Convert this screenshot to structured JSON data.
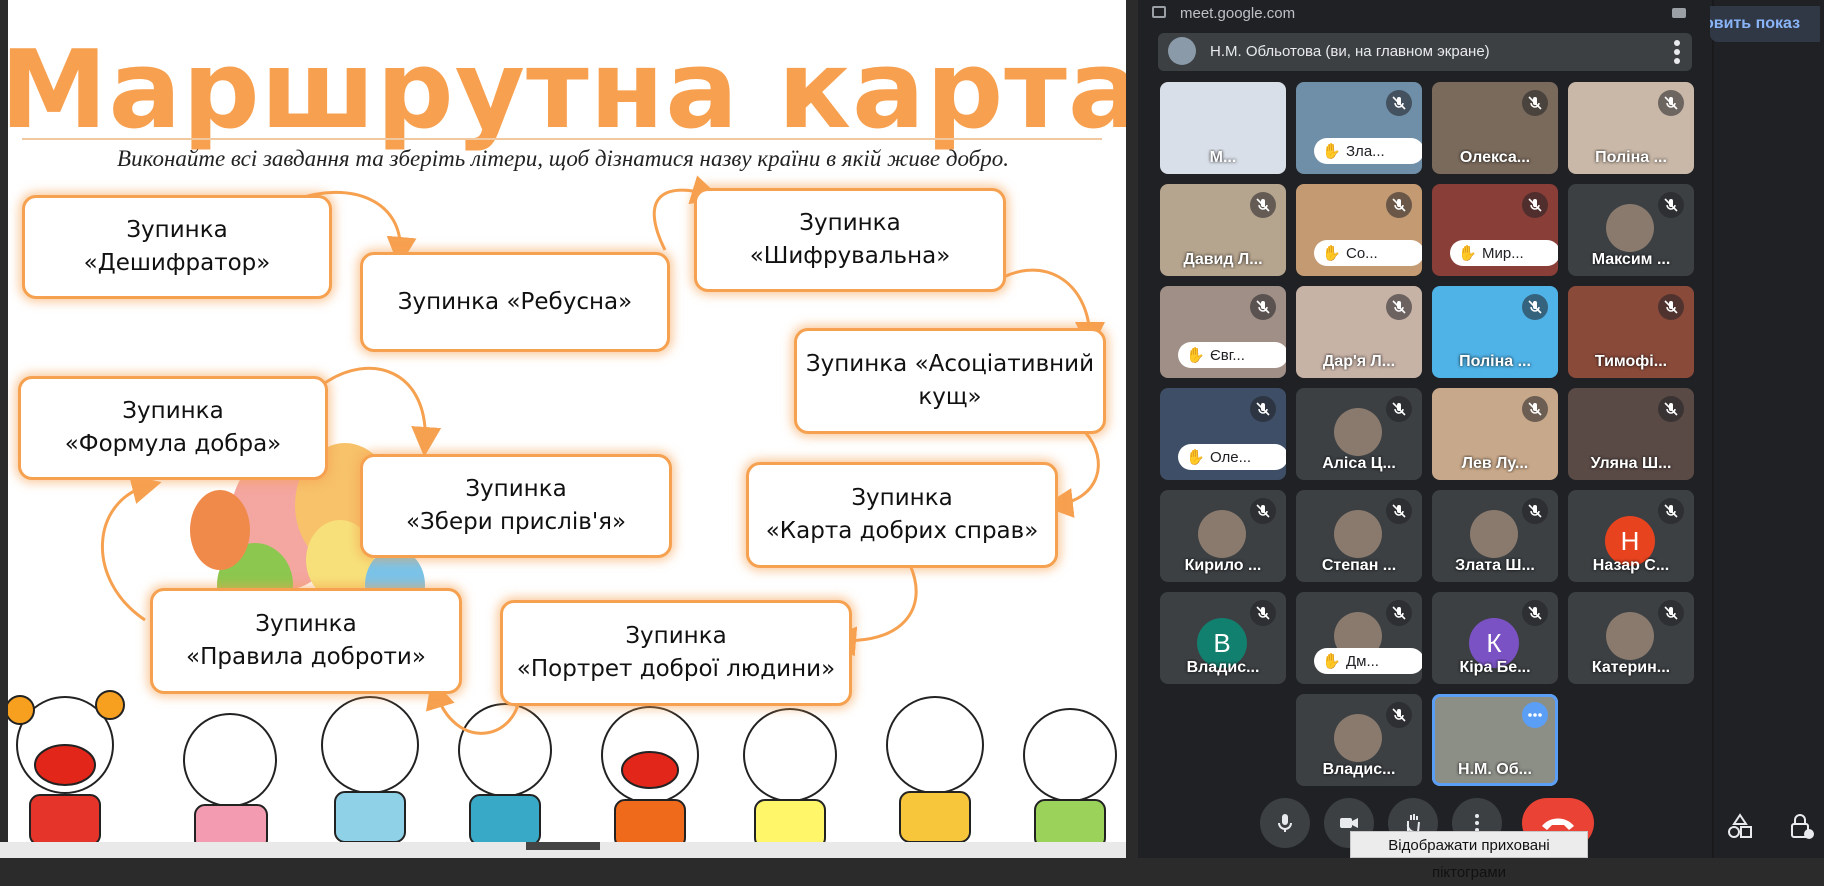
{
  "slide": {
    "title": "Маршрутна карта",
    "subtitle": "Виконайте всі завдання та зберіть літери, щоб дізнатися назву країни в якій живе добро.",
    "stops": [
      {
        "line1": "Зупинка",
        "line2": "«Дешифратор»"
      },
      {
        "line1": "Зупинка «Ребусна»",
        "line2": ""
      },
      {
        "line1": "Зупинка",
        "line2": "«Шифрувальна»"
      },
      {
        "line1": "Зупинка «Асоціативний",
        "line2": "кущ»"
      },
      {
        "line1": "Зупинка",
        "line2": "«Формула добра»"
      },
      {
        "line1": "Зупинка",
        "line2": "«Збери прислів'я»"
      },
      {
        "line1": "Зупинка",
        "line2": "«Карта добрих справ»"
      },
      {
        "line1": "Зупинка",
        "line2": "«Правила доброти»"
      },
      {
        "line1": "Зупинка",
        "line2": "«Портрет доброї людини»"
      }
    ]
  },
  "meet": {
    "url": "meet.google.com",
    "speaker_label": "Н.М. Обльотова (ви, на главном экране)",
    "participants": [
      {
        "name": "М...",
        "muted": false,
        "hand": "",
        "bg": "#d9dfe8",
        "letter": "",
        "letter_color": ""
      },
      {
        "name": "",
        "muted": true,
        "hand": "Зла...",
        "bg": "#6f8fa8",
        "letter": "",
        "letter_color": ""
      },
      {
        "name": "Олекса...",
        "muted": true,
        "hand": "",
        "bg": "#7a6a5c",
        "letter": "",
        "letter_color": ""
      },
      {
        "name": "Поліна ...",
        "muted": true,
        "hand": "",
        "bg": "#c9b8a8",
        "letter": "",
        "letter_color": ""
      },
      {
        "name": "Давид Л...",
        "muted": true,
        "hand": "",
        "bg": "#b5a48e",
        "letter": "",
        "letter_color": ""
      },
      {
        "name": "",
        "muted": true,
        "hand": "Со...",
        "bg": "#c49a72",
        "letter": "",
        "letter_color": ""
      },
      {
        "name": "",
        "muted": true,
        "hand": "Мир...",
        "bg": "#8a3e38",
        "letter": "",
        "letter_color": ""
      },
      {
        "name": "Максим ...",
        "muted": true,
        "hand": "",
        "bg": "#3c4043",
        "letter": "",
        "letter_color": ""
      },
      {
        "name": "",
        "muted": true,
        "hand": "Євг...",
        "bg": "#a08f86",
        "letter": "",
        "letter_color": ""
      },
      {
        "name": "Дар'я Л...",
        "muted": true,
        "hand": "",
        "bg": "#c7b2a6",
        "letter": "",
        "letter_color": ""
      },
      {
        "name": "Поліна ...",
        "muted": true,
        "hand": "",
        "bg": "#4fb3e8",
        "letter": "",
        "letter_color": ""
      },
      {
        "name": "Тимофі...",
        "muted": true,
        "hand": "",
        "bg": "#8a4a3a",
        "letter": "",
        "letter_color": ""
      },
      {
        "name": "",
        "muted": true,
        "hand": "Оле...",
        "bg": "#3d4e66",
        "letter": "",
        "letter_color": ""
      },
      {
        "name": "Аліса Ц...",
        "muted": true,
        "hand": "",
        "bg": "#3c4043",
        "letter": "",
        "letter_color": ""
      },
      {
        "name": "Лев Лу...",
        "muted": true,
        "hand": "",
        "bg": "#c8a88a",
        "letter": "",
        "letter_color": ""
      },
      {
        "name": "Уляна Ш...",
        "muted": true,
        "hand": "",
        "bg": "#5a4a46",
        "letter": "",
        "letter_color": ""
      },
      {
        "name": "Кирило ...",
        "muted": true,
        "hand": "",
        "bg": "#3c4043",
        "letter": "",
        "letter_color": ""
      },
      {
        "name": "Степан ...",
        "muted": true,
        "hand": "",
        "bg": "#3c4043",
        "letter": "",
        "letter_color": ""
      },
      {
        "name": "Злата Ш...",
        "muted": true,
        "hand": "",
        "bg": "#3c4043",
        "letter": "",
        "letter_color": ""
      },
      {
        "name": "Назар С...",
        "muted": true,
        "hand": "",
        "bg": "#3c4043",
        "letter": "Н",
        "letter_color": "#e8431f"
      },
      {
        "name": "Владис...",
        "muted": true,
        "hand": "",
        "bg": "#3c4043",
        "letter": "В",
        "letter_color": "#12806f"
      },
      {
        "name": "",
        "muted": true,
        "hand": "Дм...",
        "bg": "#3c4043",
        "letter": "",
        "letter_color": ""
      },
      {
        "name": "Кіра Бе...",
        "muted": true,
        "hand": "",
        "bg": "#3c4043",
        "letter": "К",
        "letter_color": "#7b52c4"
      },
      {
        "name": "Катерин...",
        "muted": true,
        "hand": "",
        "bg": "#3c4043",
        "letter": "",
        "letter_color": ""
      },
      {
        "name": "Владис...",
        "muted": true,
        "hand": "",
        "bg": "#3c4043",
        "letter": "",
        "letter_color": ""
      },
      {
        "name": "Н.М. Об...",
        "muted": false,
        "hand": "",
        "bg": "#8b8f86",
        "letter": "",
        "letter_color": ""
      }
    ],
    "tooltip": "Відображати приховані піктограми"
  },
  "right": {
    "present_label": "овить показ"
  },
  "colors": {
    "accent": "#f6a150",
    "meet_bg": "#202124",
    "tile_bg": "#3c4043",
    "end_call": "#ea4335",
    "active_border": "#5b9ef6"
  }
}
